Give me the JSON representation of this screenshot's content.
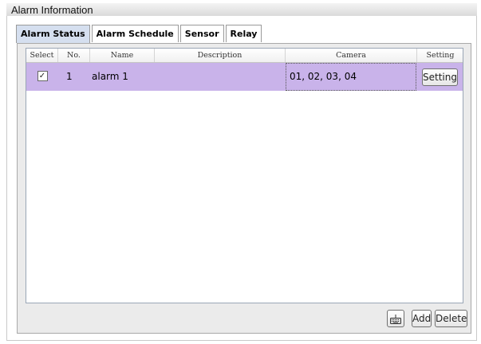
{
  "section": {
    "title": "Alarm Information"
  },
  "tabs": [
    {
      "label": "Alarm Status",
      "active": true
    },
    {
      "label": "Alarm Schedule",
      "active": false
    },
    {
      "label": "Sensor",
      "active": false
    },
    {
      "label": "Relay",
      "active": false
    }
  ],
  "table": {
    "columns": [
      "Select",
      "No.",
      "Name",
      "Description",
      "Camera",
      "Setting"
    ],
    "rows": [
      {
        "selected": true,
        "no": "1",
        "name": "alarm 1",
        "description": "",
        "camera": "01, 02, 03, 04",
        "setting_label": "Setting"
      }
    ]
  },
  "footer": {
    "keyboard_icon": "keyboard-icon",
    "add_label": "Add",
    "delete_label": "Delete"
  },
  "colors": {
    "selected_row": "#c9b3ea",
    "active_tab": "#d5dfef"
  }
}
